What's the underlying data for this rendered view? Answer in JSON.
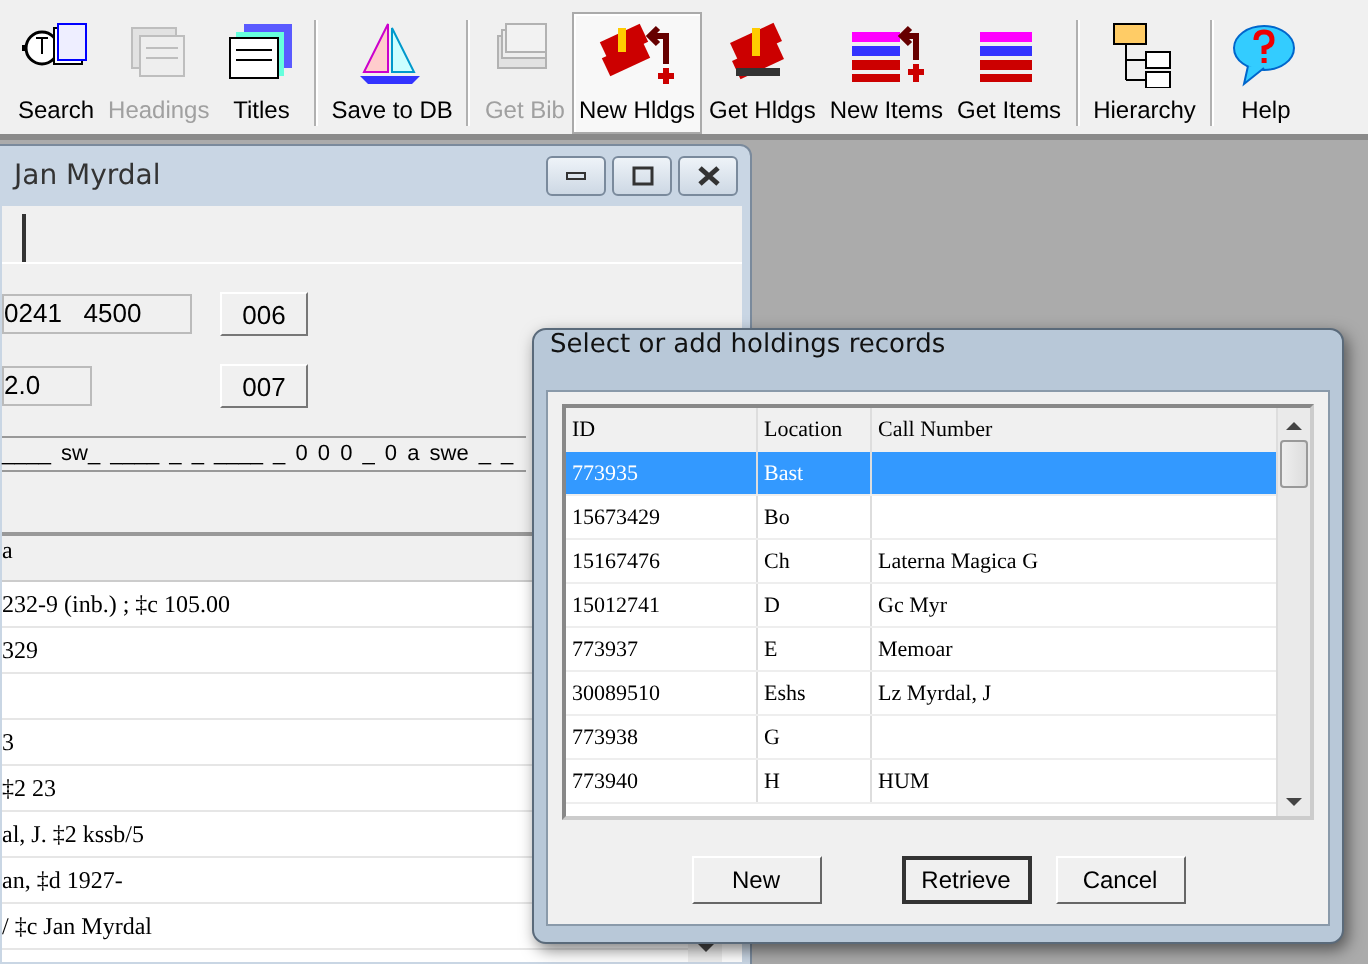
{
  "toolbar": [
    {
      "label": "Search",
      "kind": "search",
      "disabled": false,
      "pressed": false
    },
    {
      "label": "Headings",
      "kind": "headings",
      "disabled": true,
      "pressed": false
    },
    {
      "label": "Titles",
      "kind": "titles",
      "disabled": false,
      "pressed": false,
      "separator_after": true
    },
    {
      "label": "Save to DB",
      "kind": "boat",
      "disabled": false,
      "pressed": false,
      "separator_after": true
    },
    {
      "label": "Get Bib",
      "kind": "cards",
      "disabled": true,
      "pressed": false
    },
    {
      "label": "New Hldgs",
      "kind": "books-new",
      "disabled": false,
      "pressed": true
    },
    {
      "label": "Get Hldgs",
      "kind": "books",
      "disabled": false,
      "pressed": false
    },
    {
      "label": "New Items",
      "kind": "stack-new",
      "disabled": false,
      "pressed": false
    },
    {
      "label": "Get Items",
      "kind": "stack",
      "disabled": false,
      "pressed": false,
      "separator_after": true
    },
    {
      "label": "Hierarchy",
      "kind": "tree",
      "disabled": false,
      "pressed": false,
      "separator_after": true
    },
    {
      "label": "Help",
      "kind": "help",
      "disabled": false,
      "pressed": false
    }
  ],
  "record_window": {
    "title": "Jan Myrdal",
    "fields": [
      {
        "value": "0241   4500",
        "button": "006"
      },
      {
        "value": "2.0",
        "button": "007"
      }
    ],
    "fixed_fields": "____ sw_ ____ _ _ ____ _ 0 0 0 _ 0 a swe _ _",
    "list": {
      "column": "a",
      "rows": [
        "232-9 (inb.) ; ‡c 105.00",
        "329",
        "",
        "3",
        "‡2 23",
        "al, J. ‡2 kssb/5",
        "an, ‡d 1927-",
        "/ ‡c Jan Myrdal"
      ]
    }
  },
  "dialog": {
    "title": "Select or add holdings records",
    "columns": [
      "ID",
      "Location",
      "Call Number"
    ],
    "rows": [
      {
        "cells": [
          "773935",
          "Bast",
          ""
        ],
        "selected": true
      },
      {
        "cells": [
          "15673429",
          "Bo",
          ""
        ],
        "selected": false
      },
      {
        "cells": [
          "15167476",
          "Ch",
          "Laterna Magica G"
        ],
        "selected": false
      },
      {
        "cells": [
          "15012741",
          "D",
          "Gc Myr"
        ],
        "selected": false
      },
      {
        "cells": [
          "773937",
          "E",
          "Memoar"
        ],
        "selected": false
      },
      {
        "cells": [
          "30089510",
          "Eshs",
          "Lz Myrdal, J"
        ],
        "selected": false
      },
      {
        "cells": [
          "773938",
          "G",
          ""
        ],
        "selected": false
      },
      {
        "cells": [
          "773940",
          "H",
          "HUM"
        ],
        "selected": false
      }
    ],
    "buttons": [
      {
        "label": "New",
        "default": false
      },
      {
        "label": "Retrieve",
        "default": true
      },
      {
        "label": "Cancel",
        "default": false
      }
    ]
  }
}
